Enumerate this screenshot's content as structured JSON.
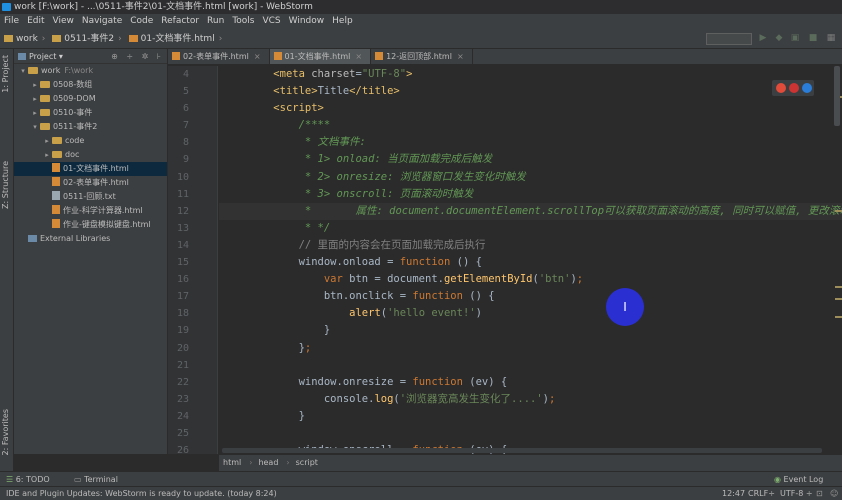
{
  "window": {
    "title": "work [F:\\work] - ...\\0511-事件2\\01-文档事件.html [work] - WebStorm"
  },
  "menu": [
    "File",
    "Edit",
    "View",
    "Navigate",
    "Code",
    "Refactor",
    "Run",
    "Tools",
    "VCS",
    "Window",
    "Help"
  ],
  "breadcrumb": {
    "items": [
      "work",
      "0511-事件2",
      "01-文档事件.html"
    ]
  },
  "project_panel": {
    "title": "Project",
    "tree": [
      {
        "label": "work",
        "extra": "F:\\work",
        "kind": "folder",
        "indent": 0,
        "open": true
      },
      {
        "label": "0508-数组",
        "kind": "folder",
        "indent": 1,
        "open": false
      },
      {
        "label": "0509-DOM",
        "kind": "folder",
        "indent": 1,
        "open": false
      },
      {
        "label": "0510-事件",
        "kind": "folder",
        "indent": 1,
        "open": false
      },
      {
        "label": "0511-事件2",
        "kind": "folder",
        "indent": 1,
        "open": true
      },
      {
        "label": "code",
        "kind": "folder",
        "indent": 2,
        "open": false
      },
      {
        "label": "doc",
        "kind": "folder",
        "indent": 2,
        "open": false
      },
      {
        "label": "01-文档事件.html",
        "kind": "file",
        "indent": 2,
        "selected": true
      },
      {
        "label": "02-表单事件.html",
        "kind": "file",
        "indent": 2
      },
      {
        "label": "0511-回顾.txt",
        "kind": "txt",
        "indent": 2
      },
      {
        "label": "作业-科学计算器.html",
        "kind": "file",
        "indent": 2
      },
      {
        "label": "作业-键盘模拟键盘.html",
        "kind": "file",
        "indent": 2
      },
      {
        "label": "External Libraries",
        "kind": "libs",
        "indent": 0
      }
    ]
  },
  "side_tabs": {
    "project": "1: Project",
    "structure": "Z: Structure",
    "favorites": "2: Favorites"
  },
  "editor_tabs": [
    {
      "label": "02-表单事件.html",
      "active": false
    },
    {
      "label": "01-文档事件.html",
      "active": true
    },
    {
      "label": "12-返回顶部.html",
      "active": false
    }
  ],
  "editor": {
    "line_numbers": [
      "4",
      "5",
      "6",
      "7",
      "8",
      "9",
      "10",
      "11",
      "12",
      "13",
      "14",
      "15",
      "16",
      "17",
      "18",
      "19",
      "20",
      "21",
      "22",
      "23",
      "24",
      "25",
      "26"
    ],
    "breadcrumb": [
      "html",
      "head",
      "script"
    ]
  },
  "cursor_mark": "I",
  "bottom_tabs": {
    "todo": "6: TODO",
    "terminal": "Terminal",
    "event_log": "Event Log"
  },
  "status": {
    "message": "IDE and Plugin Updates: WebStorm is ready to update. (today 8:24)",
    "position": "12:47",
    "line_sep": "CRLF÷",
    "encoding": "UTF-8 ÷"
  },
  "colors": {
    "background": "#2b2b2b",
    "keyword": "#cc7832",
    "string": "#6a8759",
    "comment": "#629755",
    "tag": "#e8bf6a",
    "cursor_dot": "#2a2fd1"
  }
}
